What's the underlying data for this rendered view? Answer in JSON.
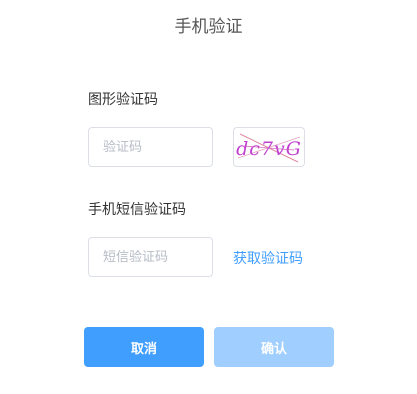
{
  "dialog": {
    "title": "手机验证"
  },
  "image_captcha": {
    "label": "图形验证码",
    "placeholder": "验证码",
    "value": "",
    "captcha_text": "dc7vG",
    "captcha_color": "#c040d0"
  },
  "sms_code": {
    "label": "手机短信验证码",
    "placeholder": "短信验证码",
    "value": "",
    "get_code_label": "获取验证码"
  },
  "buttons": {
    "cancel_label": "取消",
    "confirm_label": "确认"
  },
  "colors": {
    "primary": "#409eff",
    "primary_disabled": "#a0cfff"
  }
}
